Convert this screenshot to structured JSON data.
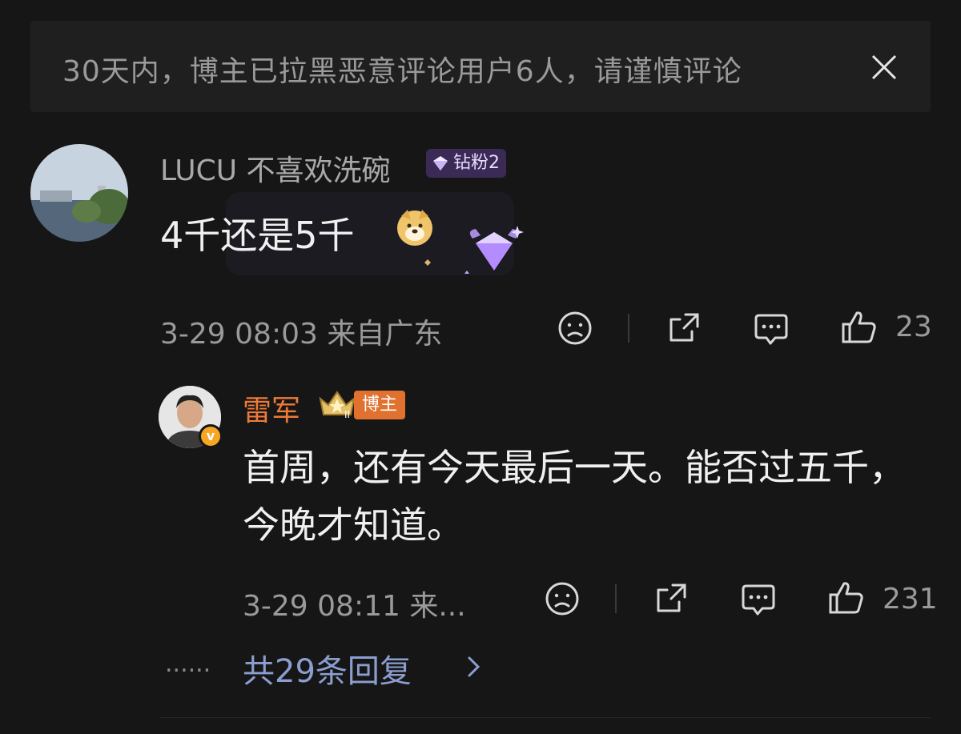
{
  "notice": {
    "text": "30天内，博主已拉黑恶意评论用户6人，请谨慎评论"
  },
  "comment": {
    "username": "LUCU 不喜欢洗碗",
    "fan_badge": "钻粉2",
    "text": "4千还是5千",
    "time_location": "3-29 08:03 来自广东",
    "like_count": "23"
  },
  "reply": {
    "username": "雷军",
    "host_badge": "博主",
    "text": "首周，还有今天最后一天。能否过五千，今晚才知道。",
    "time_location": "3-29 08:11 来...",
    "like_count": "231"
  },
  "more": {
    "dots": "......",
    "label": "共29条回复"
  },
  "colors": {
    "background": "#161616",
    "reply_name": "#ee7a3a",
    "link": "#8c9ecf",
    "fan_badge": "#3a2a55"
  }
}
